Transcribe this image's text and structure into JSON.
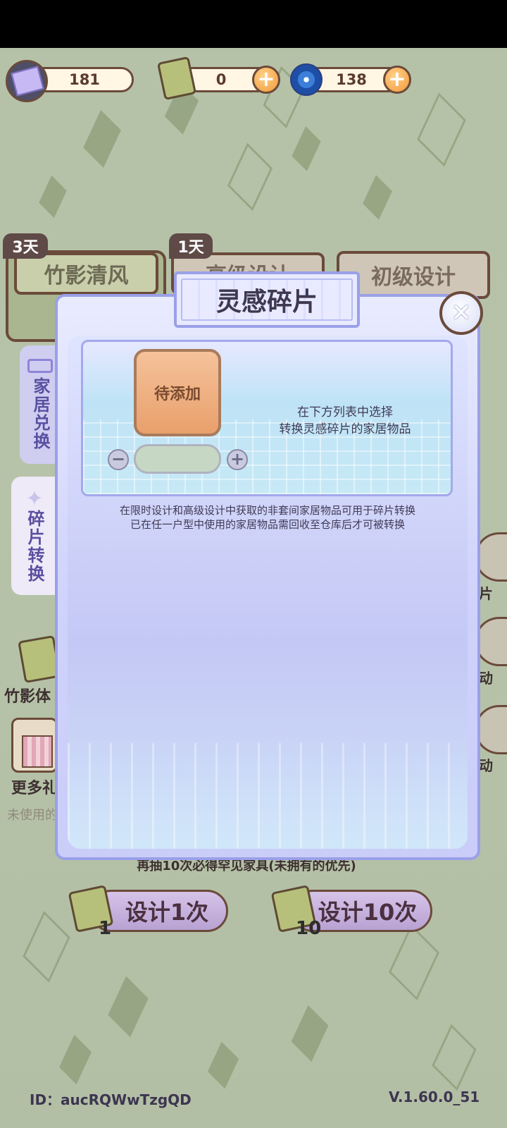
{
  "currency": {
    "inspiration": "181",
    "bamboo_ticket": "0",
    "swirl_gem": "138"
  },
  "pool_tabs": {
    "bamboo_event": {
      "label": "竹影清风",
      "days": "3天"
    },
    "senior_design": {
      "label": "高级设计",
      "days": "1天"
    },
    "junior_design": {
      "label": "初级设计"
    }
  },
  "side_tabs": {
    "furniture_exchange": "家居兑换",
    "fragment_convert": "碎片转换"
  },
  "left_panel": {
    "bamboo_label": "竹影体",
    "more_gifts_label": "更多礼",
    "unused_label": "未使用的"
  },
  "right_panel": {
    "chars": [
      "片",
      "动",
      "动"
    ]
  },
  "bottom": {
    "guarantee_text": "再抽10次必得罕见家具(未拥有的优先)",
    "design_once": "设计1次",
    "design_once_cost": "1",
    "design_ten": "设计10次",
    "design_ten_cost": "10",
    "player_id": "ID：aucRQWwTzgQD",
    "version": "V.1.60.0_51"
  },
  "modal": {
    "title": "灵感碎片",
    "slot_label": "待添加",
    "instruction_line1": "在下方列表中选择",
    "instruction_line2": "转换灵感碎片的家居物品",
    "note_line1": "在限时设计和高级设计中获取的非套间家居物品可用于碎片转换",
    "note_line2": "已在任一户型中使用的家居物品需回收至仓库后才可被转换",
    "minus": "−",
    "plus": "+",
    "close": "✕"
  },
  "colors": {
    "modal_border": "#9aa0e8",
    "slot_fill": "#e9a06c",
    "brown_outline": "#6b4a3a"
  }
}
